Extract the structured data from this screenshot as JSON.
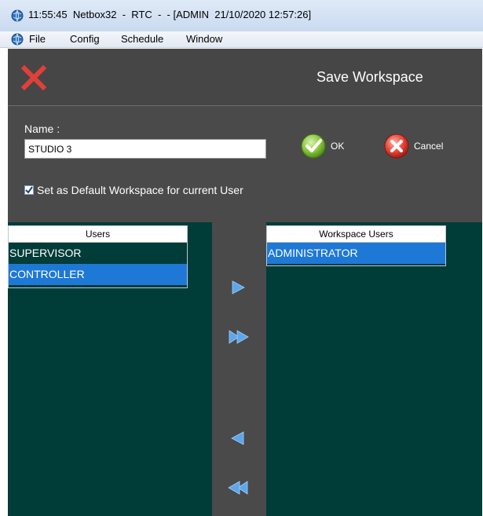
{
  "titlebar": {
    "text": "11:55:45  Netbox32  -  RTC  -  - [ADMIN  21/10/2020 12:57:26]"
  },
  "menu": {
    "items": [
      "File",
      "Config",
      "Schedule",
      "Window"
    ]
  },
  "dialog": {
    "title": "Save Workspace",
    "name_label": "Name :",
    "name_value": "STUDIO 3",
    "ok_label": "OK",
    "cancel_label": "Cancel",
    "default_checkbox_label": "Set as Default Workspace for current User",
    "default_checked": true
  },
  "users_list": {
    "header": "Users",
    "items": [
      "SUPERVISOR",
      "CONTROLLER"
    ],
    "selected": "CONTROLLER"
  },
  "workspace_users_list": {
    "header": "Workspace Users",
    "items": [
      "ADMINISTRATOR"
    ],
    "selected": "ADMINISTRATOR"
  },
  "colors": {
    "dialog_bg": "#4a4a4a",
    "list_bg": "#003c38",
    "selection": "#1e78d6",
    "close_red": "#e0403a",
    "arrow_blue": "#5ea6e8"
  },
  "icons": {
    "app": "netbox-globe-icon",
    "close": "close-x-icon",
    "ok": "green-check-circle-icon",
    "cancel": "red-x-circle-icon",
    "add_one": "arrow-right-icon",
    "add_all": "double-arrow-right-icon",
    "remove_one": "arrow-left-icon",
    "remove_all": "double-arrow-left-icon"
  }
}
